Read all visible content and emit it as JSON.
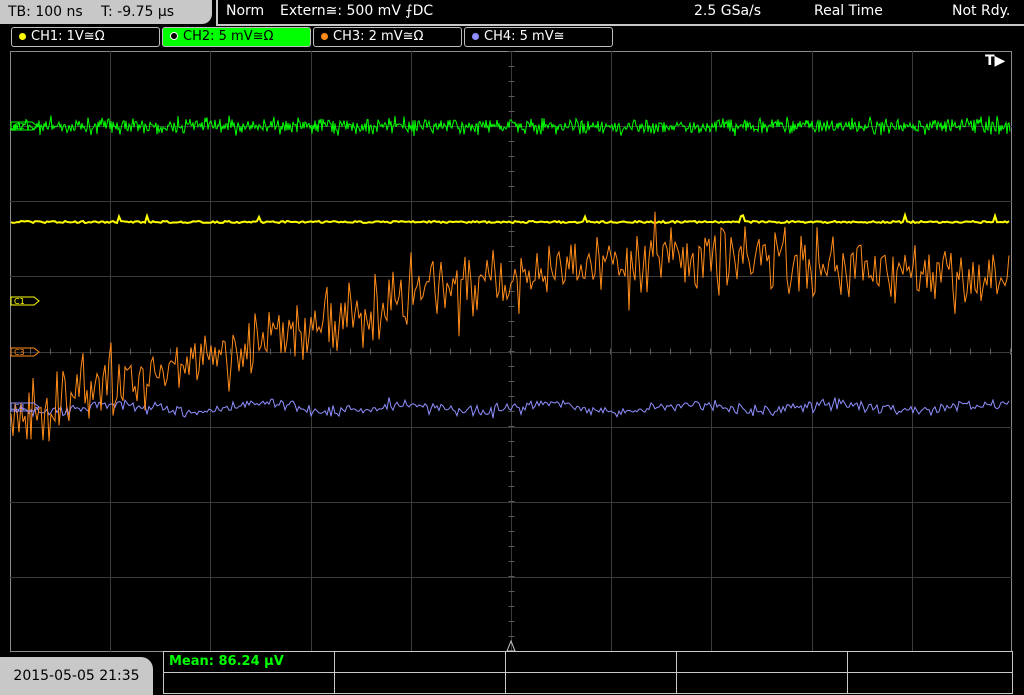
{
  "header": {
    "timebase": "TB: 100 ns",
    "trigger_time": "T: -9.75 µs",
    "trigger_mode": "Norm",
    "trigger_source": "Extern≅: 500 mV ⨍DC",
    "sample_rate": "2.5 GSa/s",
    "acq_mode": "Real Time",
    "status": "Not Rdy."
  },
  "channels": [
    {
      "label": "CH1: 1V≅Ω",
      "color": "#ffff00",
      "active": false
    },
    {
      "label": "CH2: 5 mV≅Ω",
      "color": "#00ff00",
      "active": true
    },
    {
      "label": "CH3: 2 mV≅Ω",
      "color": "#ff8c1a",
      "active": false
    },
    {
      "label": "CH4: 5 mV≅",
      "color": "#8f8fff",
      "active": false
    }
  ],
  "markers": {
    "c1": "C1",
    "c3": "C3",
    "c2": "C2",
    "c4": "C4",
    "trigger_pos": "T▶"
  },
  "measurement": {
    "label": "Mean: 86.24 µV"
  },
  "footer": {
    "datetime": "2015-05-05 21:35"
  },
  "colors": {
    "ch1": "#ffff00",
    "ch2": "#00ff00",
    "ch3": "#ff8c1a",
    "ch4": "#8f8fff",
    "grid": "#3a3a3a",
    "frame": "#c8c8c8"
  }
}
